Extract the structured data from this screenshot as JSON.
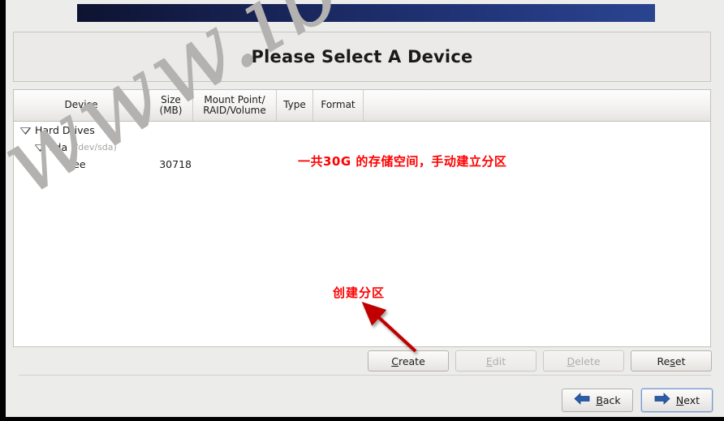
{
  "window": {
    "title": "Please Select A Device"
  },
  "table": {
    "columns": [
      {
        "id": "device",
        "label": "Device"
      },
      {
        "id": "size",
        "label": "Size\n(MB)",
        "label_line1": "Size",
        "label_line2": "(MB)"
      },
      {
        "id": "mount",
        "label": "Mount Point/\nRAID/Volume",
        "label_line1": "Mount Point/",
        "label_line2": "RAID/Volume"
      },
      {
        "id": "type",
        "label": "Type"
      },
      {
        "id": "format",
        "label": "Format"
      }
    ],
    "rows": [
      {
        "indent": 0,
        "expander": "expanded",
        "device": "Hard Drives",
        "device_path": "",
        "size": "",
        "mount": "",
        "type": "",
        "format": ""
      },
      {
        "indent": 1,
        "expander": "expanded",
        "device": "sda",
        "device_path": "(/dev/sda)",
        "size": "",
        "mount": "",
        "type": "",
        "format": ""
      },
      {
        "indent": 2,
        "expander": "none",
        "device": "Free",
        "device_path": "",
        "size": "30718",
        "mount": "",
        "type": "",
        "format": ""
      }
    ]
  },
  "actions": {
    "create": {
      "label": "Create",
      "accel": "C",
      "enabled": true
    },
    "edit": {
      "label": "Edit",
      "accel": "E",
      "enabled": false
    },
    "delete": {
      "label": "Delete",
      "accel": "D",
      "enabled": false
    },
    "reset": {
      "label": "Reset",
      "accel": "s",
      "enabled": true
    }
  },
  "nav": {
    "back": {
      "label": "Back",
      "accel": "B",
      "icon": "arrow-left-icon"
    },
    "next": {
      "label": "Next",
      "accel": "N",
      "icon": "arrow-right-icon",
      "focused": true
    }
  },
  "annotations": [
    {
      "id": "free-space-note",
      "text": "一共30G 的存储空间，手动建立分区",
      "color": "#ff0000",
      "arrow": "right"
    },
    {
      "id": "create-partition-note",
      "text": "创建分区",
      "color": "#ff0000",
      "arrow": "up-left"
    }
  ],
  "watermark": {
    "text": "www.ibeifeng.com",
    "color": "#b3b2b0"
  },
  "colors": {
    "banner_dark": "#0d1330",
    "banner_light": "#2b4490",
    "annotation_red": "#ff0000",
    "arrow_blue": "#2a5caa",
    "panel_bg": "#ececeb"
  }
}
